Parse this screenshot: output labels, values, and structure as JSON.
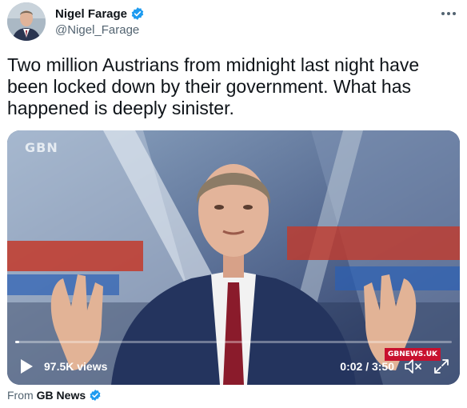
{
  "author": {
    "display_name": "Nigel Farage",
    "handle": "@Nigel_Farage",
    "avatar_icon": "person-avatar-icon",
    "verified_icon": "verified-badge-icon"
  },
  "more_icon": "more-options-icon",
  "tweet": {
    "text": "Two million Austrians from midnight last night have been locked down by their government. What has happened is deeply sinister."
  },
  "video": {
    "watermark": "GBN",
    "brand_chip": "GBNEWS.UK",
    "views": "97.5K views",
    "timecode": "0:02 / 3:50",
    "progress": 0.009,
    "play_icon": "play-icon",
    "mute_icon": "muted-speaker-icon",
    "fullscreen_icon": "fullscreen-icon"
  },
  "source": {
    "prefix": "From",
    "name": "GB News",
    "verified_icon": "verified-badge-icon"
  },
  "colors": {
    "verified_blue": "#1d9bf0",
    "brand_red": "#c8102e",
    "secondary_text": "#536471"
  }
}
